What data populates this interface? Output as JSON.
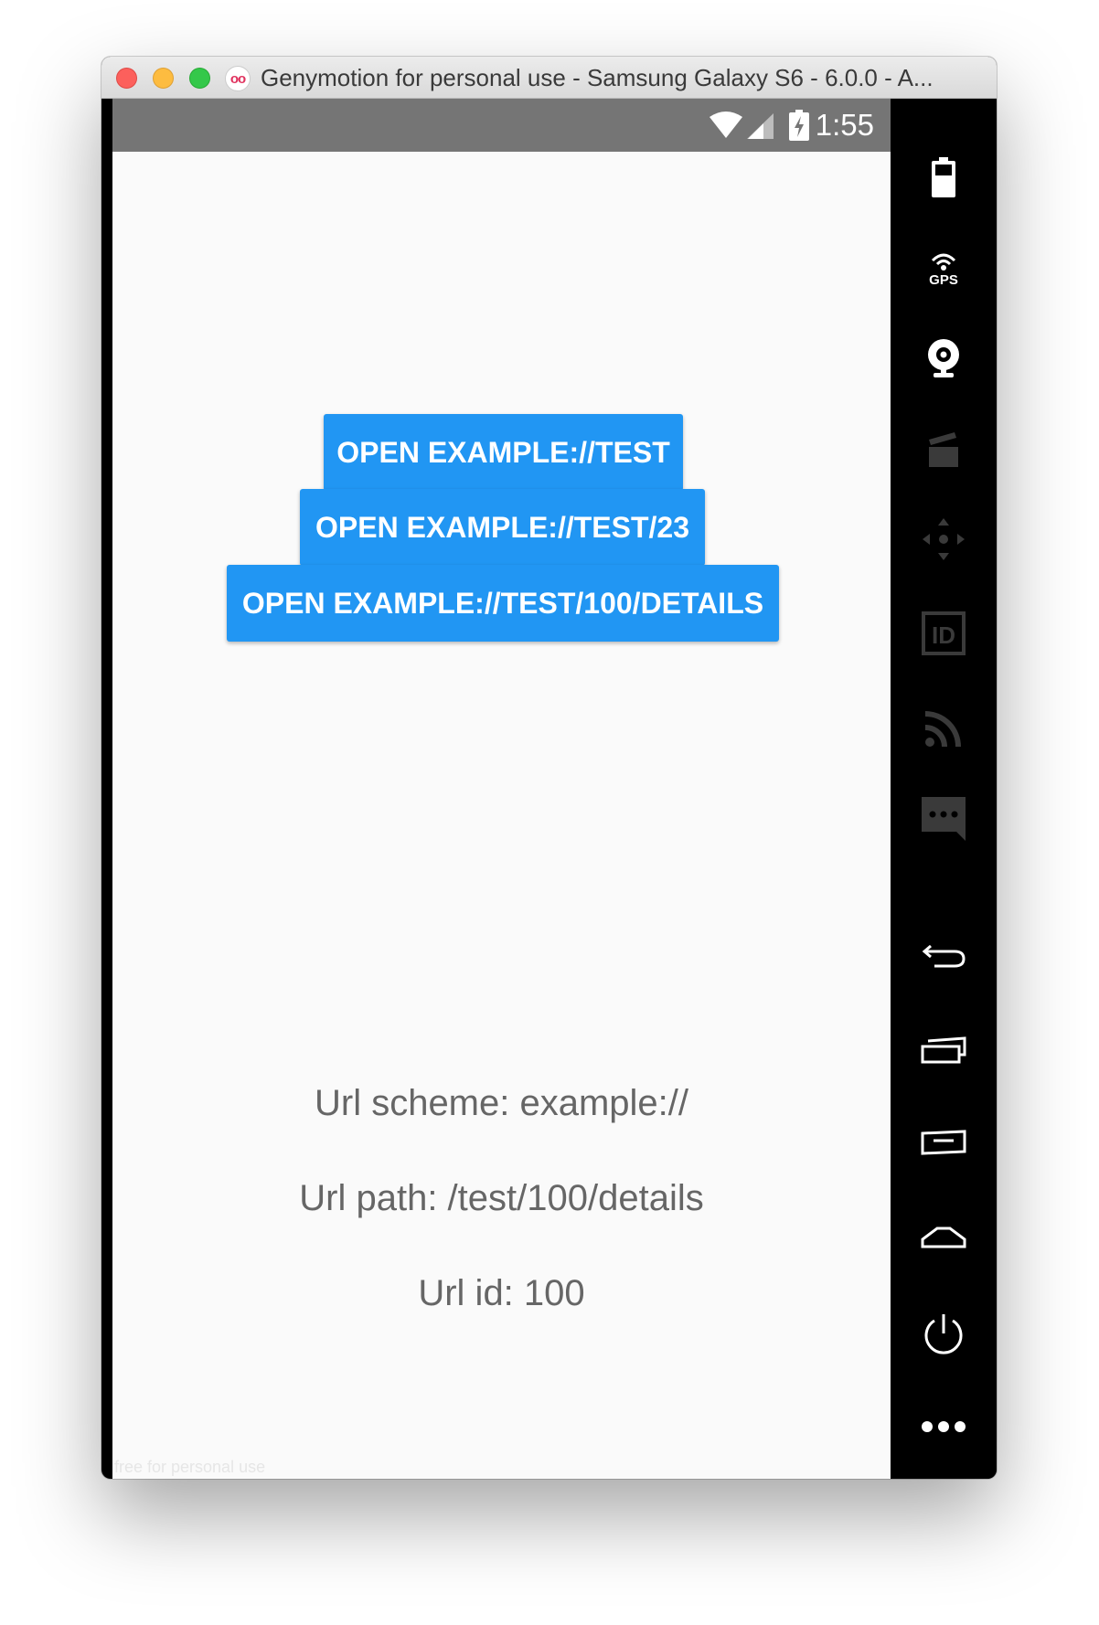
{
  "window": {
    "title": "Genymotion for personal use - Samsung Galaxy S6 - 6.0.0 - A...",
    "logo_text": "oo"
  },
  "statusbar": {
    "time": "1:55",
    "icons": [
      "wifi-icon",
      "cell-signal-icon",
      "battery-charging-icon"
    ]
  },
  "app": {
    "buttons": [
      {
        "label": "OPEN EXAMPLE://TEST"
      },
      {
        "label": "OPEN EXAMPLE://TEST/23"
      },
      {
        "label": "OPEN EXAMPLE://TEST/100/DETAILS"
      }
    ],
    "info": {
      "scheme": "Url scheme: example://",
      "path": "Url path: /test/100/details",
      "id": "Url id: 100"
    },
    "watermark": "free for personal use"
  },
  "sidebar": {
    "items": [
      {
        "icon": "battery-icon"
      },
      {
        "icon": "gps-icon",
        "label": "GPS"
      },
      {
        "icon": "webcam-icon"
      },
      {
        "icon": "video-capture-icon"
      },
      {
        "icon": "dpad-icon"
      },
      {
        "icon": "device-id-icon",
        "label": "ID"
      },
      {
        "icon": "network-icon"
      },
      {
        "icon": "sms-icon"
      },
      {
        "icon": "back-icon"
      },
      {
        "icon": "recent-apps-icon"
      },
      {
        "icon": "menu-icon"
      },
      {
        "icon": "home-icon"
      },
      {
        "icon": "power-icon"
      },
      {
        "icon": "more-icon"
      }
    ]
  },
  "colors": {
    "accent": "#2196f3",
    "statusbar": "#757575",
    "screen_bg": "#fafafa",
    "info_text": "#666666"
  }
}
